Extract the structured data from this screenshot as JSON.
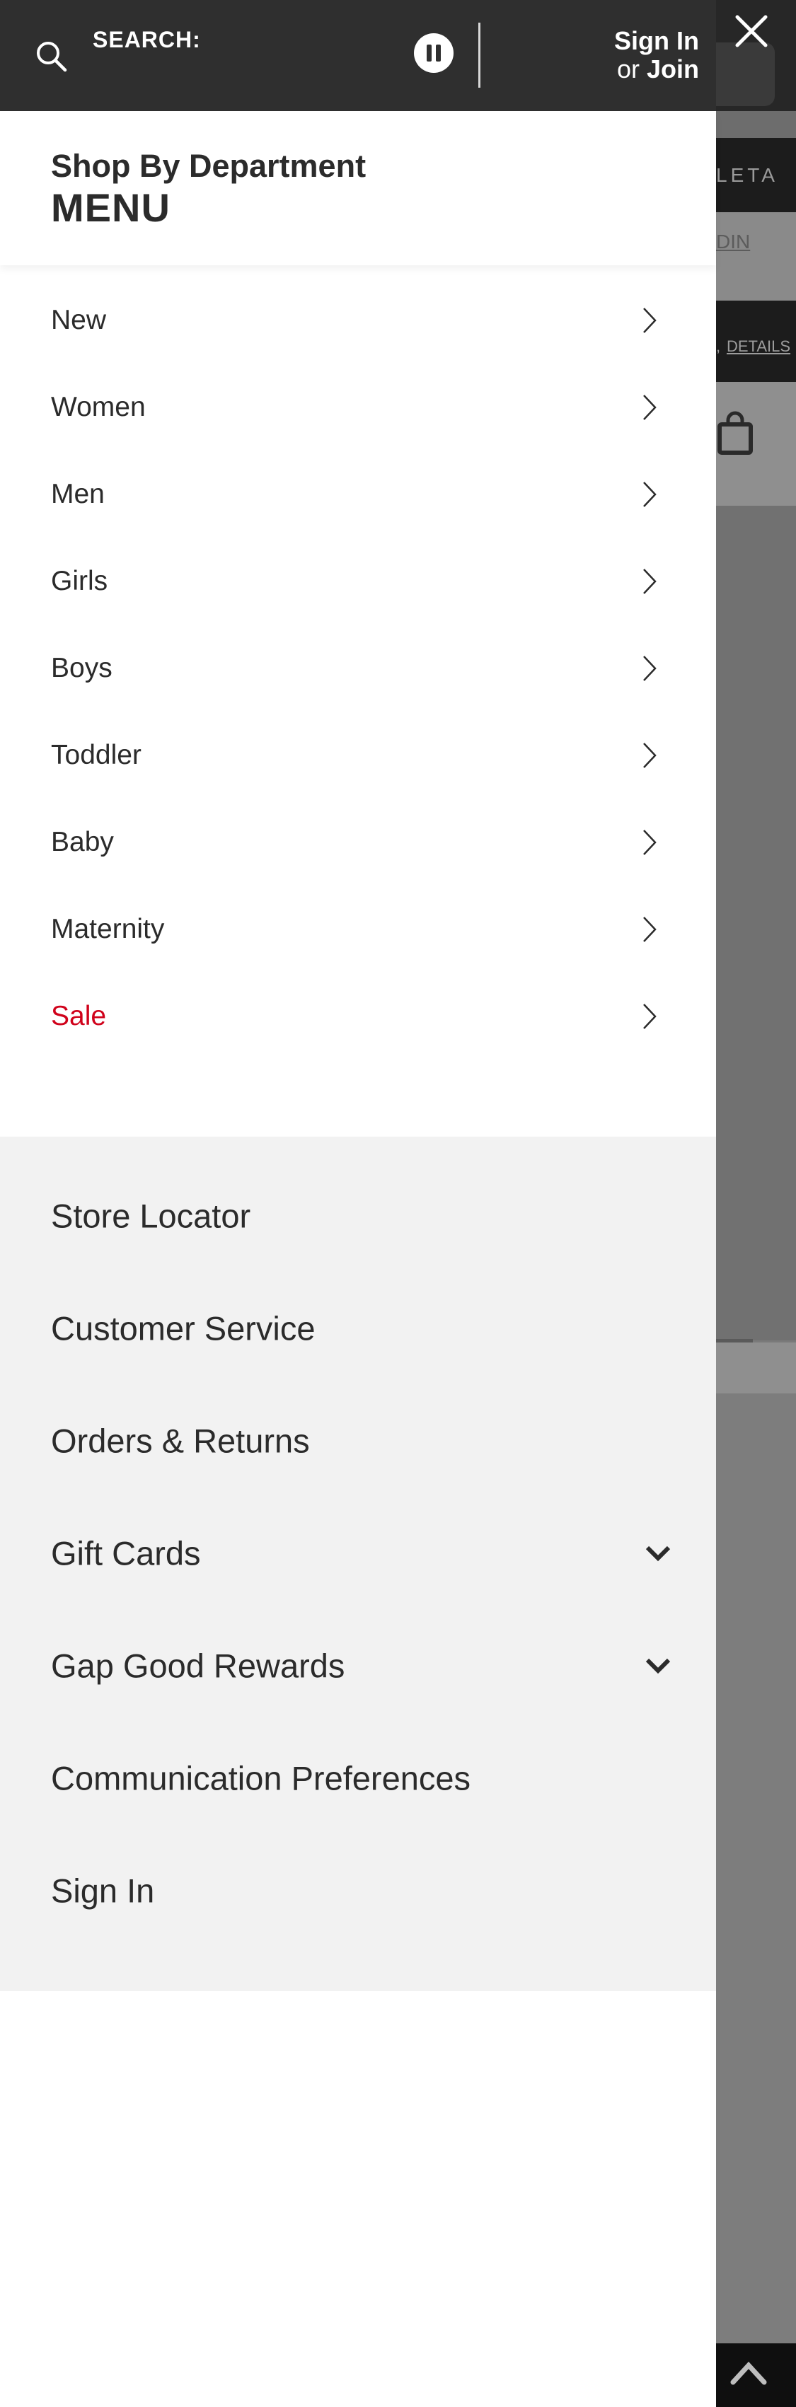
{
  "header": {
    "search_label": "SEARCH:",
    "sign_in_label": "Sign In",
    "or_label": "or",
    "join_label": "Join"
  },
  "department": {
    "subtitle": "Shop By Department",
    "title": "MENU",
    "items": [
      {
        "label": "New"
      },
      {
        "label": "Women"
      },
      {
        "label": "Men"
      },
      {
        "label": "Girls"
      },
      {
        "label": "Boys"
      },
      {
        "label": "Toddler"
      },
      {
        "label": "Baby"
      },
      {
        "label": "Maternity"
      },
      {
        "label": "Sale"
      }
    ],
    "sale_color": "#d0021b"
  },
  "utility": {
    "items": [
      {
        "label": "Store Locator"
      },
      {
        "label": "Customer Service"
      },
      {
        "label": "Orders & Returns"
      },
      {
        "label": "Gift Cards",
        "expandable": true
      },
      {
        "label": "Gap Good Rewards",
        "expandable": true
      },
      {
        "label": "Communication Preferences"
      },
      {
        "label": "Sign In"
      }
    ]
  },
  "background_page": {
    "brand_text": "LETA",
    "join_link": "DIN",
    "details_link": "DETAILS"
  },
  "icons": {
    "search": "search-icon",
    "pause": "pause-icon",
    "close": "close-icon",
    "chevron_right": "chevron-right-icon",
    "chevron_down": "chevron-down-icon",
    "bag": "shopping-bag-icon",
    "back_to_top": "chevron-up-icon"
  },
  "colors": {
    "header_bg": "#2f2f2f",
    "utility_bg": "#f2f2f2",
    "overlay": "#7a7a7a"
  }
}
